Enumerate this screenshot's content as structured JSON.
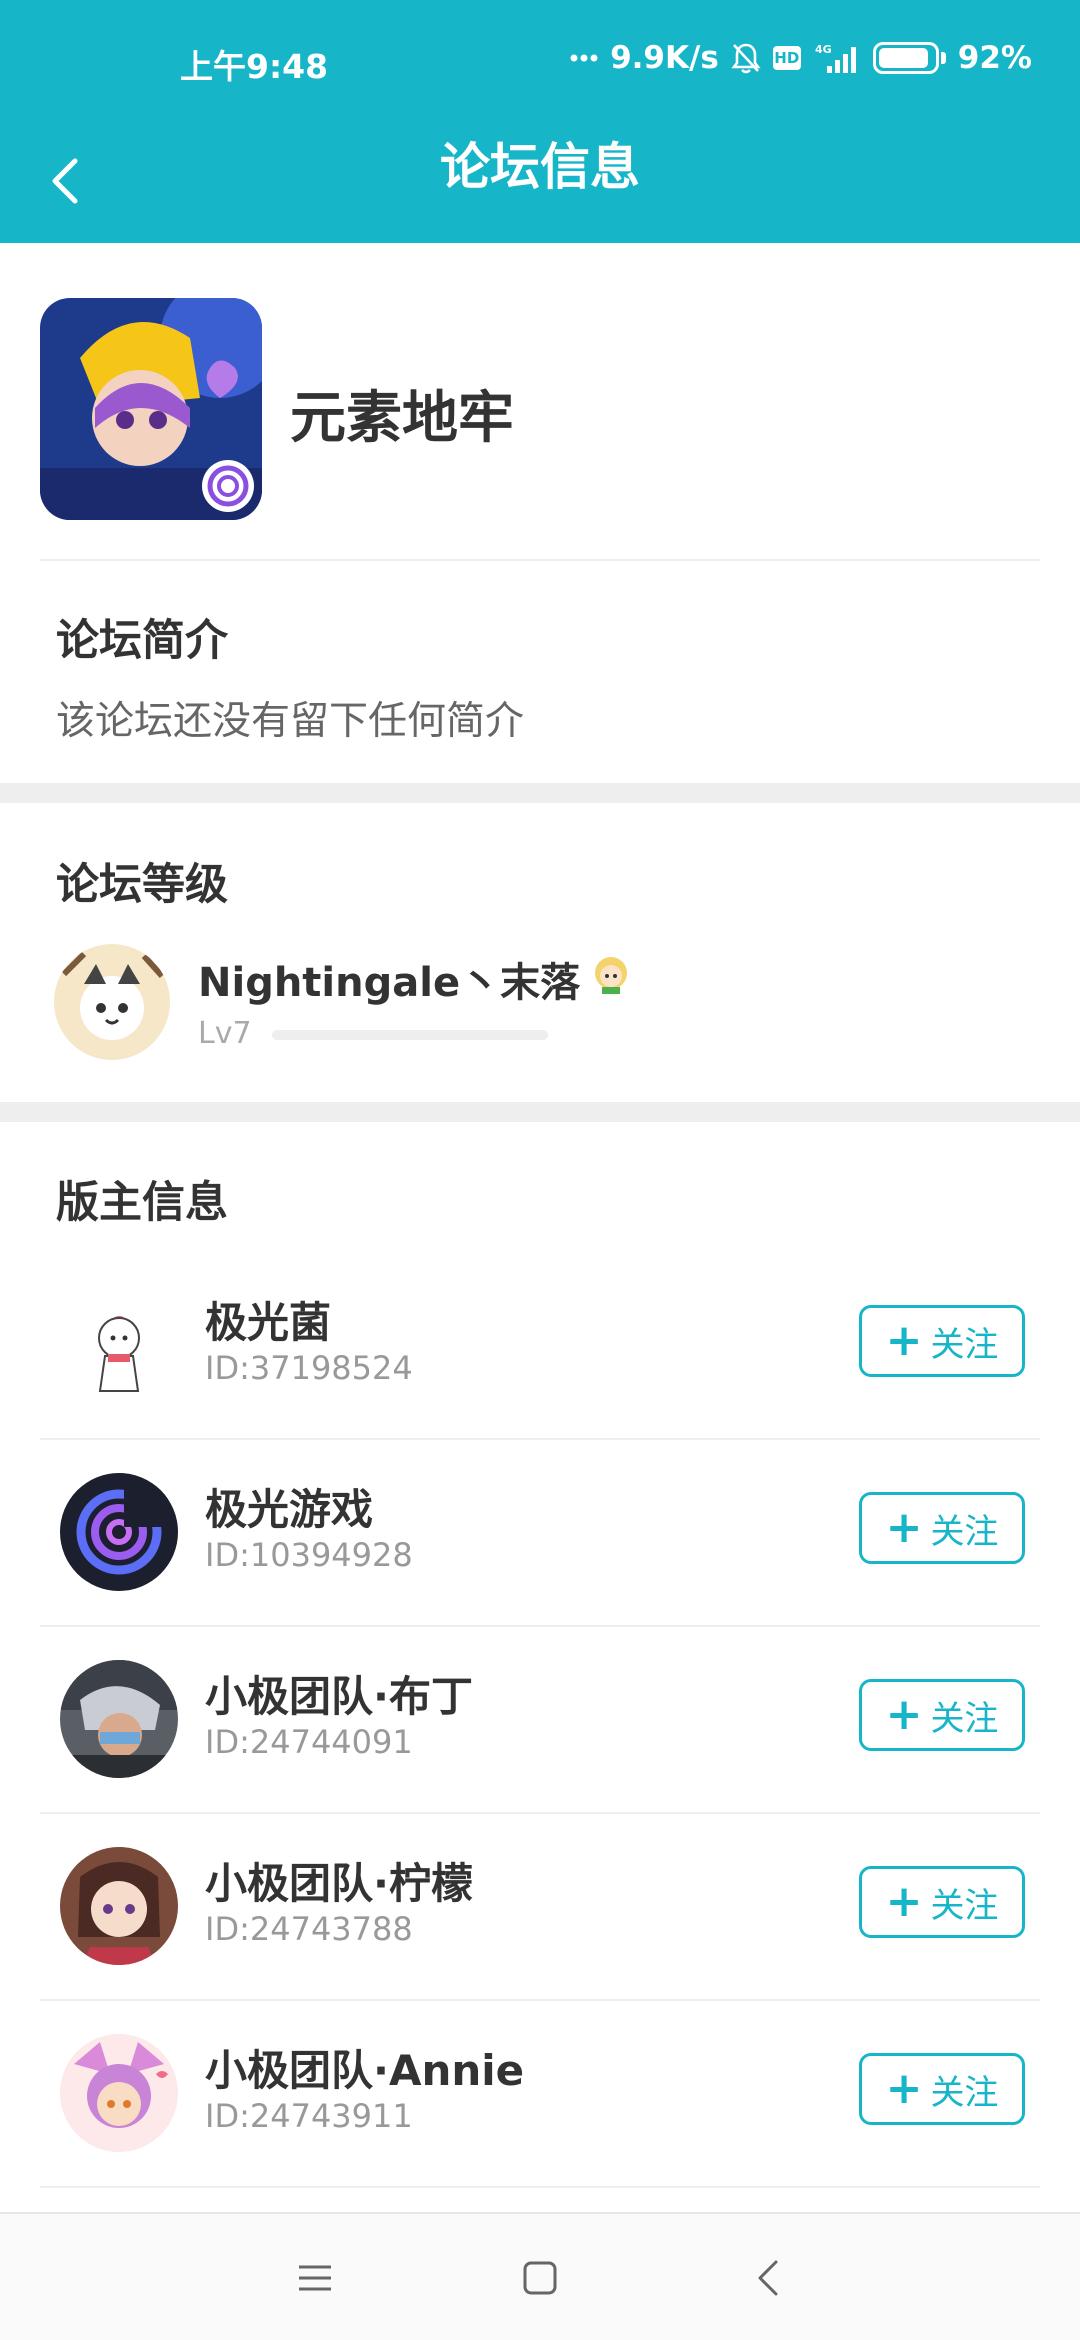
{
  "status_bar": {
    "time": "上午9:48",
    "network_speed": "9.9K/s",
    "signal_label": "4G",
    "battery": "92%",
    "battery_level": 0.92,
    "icons": [
      "dots-icon",
      "mute-bell-icon",
      "hd-icon",
      "signal-icon",
      "battery-icon"
    ]
  },
  "app_bar": {
    "title": "论坛信息",
    "back_icon": "back-arrow-icon"
  },
  "forum": {
    "name": "元素地牢",
    "logo_icon": "forum-logo-image"
  },
  "intro": {
    "title": "论坛简介",
    "text": "该论坛还没有留下任何简介"
  },
  "level": {
    "title": "论坛等级",
    "user_name": "Nightingale丶末落",
    "level_label": "Lv7",
    "progress": 0.0
  },
  "moderators": {
    "title": "版主信息",
    "follow_label": "关注",
    "items": [
      {
        "name": "极光菌",
        "id": "ID:37198524"
      },
      {
        "name": "极光游戏",
        "id": "ID:10394928"
      },
      {
        "name": "小极团队·布丁",
        "id": "ID:24744091"
      },
      {
        "name": "小极团队·柠檬",
        "id": "ID:24743788"
      },
      {
        "name": "小极团队·Annie",
        "id": "ID:24743911"
      }
    ]
  },
  "nav_bar": {
    "icons": [
      "menu-icon",
      "home-square-icon",
      "back-triangle-icon"
    ]
  },
  "colors": {
    "accent": "#17b5c8",
    "text_primary": "#333333",
    "text_secondary": "#999999",
    "divider": "#eeeeee"
  }
}
